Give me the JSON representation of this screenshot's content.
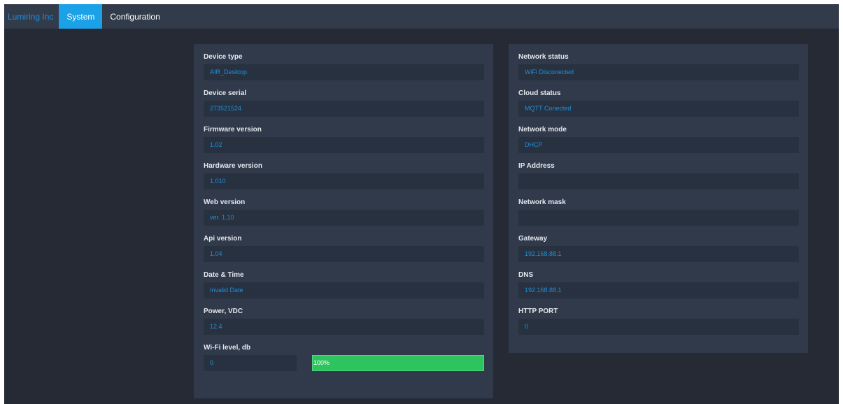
{
  "navbar": {
    "brand": "Lumiring Inc",
    "tabs": [
      {
        "label": "System",
        "active": true
      },
      {
        "label": "Configuration",
        "active": false
      }
    ]
  },
  "left_panel": {
    "fields": [
      {
        "label": "Device type",
        "value": "AIR_Desktop"
      },
      {
        "label": "Device serial",
        "value": "273521524"
      },
      {
        "label": "Firmware version",
        "value": "1.02"
      },
      {
        "label": "Hardware version",
        "value": "1.010"
      },
      {
        "label": "Web version",
        "value": "ver. 1.10"
      },
      {
        "label": "Api version",
        "value": "1.04"
      },
      {
        "label": "Date & Time",
        "value": "Invalid Date"
      },
      {
        "label": "Power, VDC",
        "value": "12.4"
      }
    ],
    "wifi": {
      "label": "Wi-Fi level, db",
      "value": "0",
      "progress_text": "100%",
      "progress_percent": 100
    }
  },
  "right_panel": {
    "fields": [
      {
        "label": "Network status",
        "value": "WiFi Disconected"
      },
      {
        "label": "Cloud status",
        "value": "MQTT Conected"
      },
      {
        "label": "Network mode",
        "value": "DHCP"
      },
      {
        "label": "IP Address",
        "value": ""
      },
      {
        "label": "Network mask",
        "value": ""
      },
      {
        "label": "Gateway",
        "value": "192.168.88.1"
      },
      {
        "label": "DNS",
        "value": "192.168.88.1"
      },
      {
        "label": "HTTP PORT",
        "value": "0"
      }
    ]
  },
  "colors": {
    "background": "#252a35",
    "navbar": "#323b4a",
    "panel": "#313a4a",
    "field": "#283140",
    "accent": "#1ba1e8",
    "value_text": "#1f8fd6",
    "progress": "#2dc35f"
  }
}
